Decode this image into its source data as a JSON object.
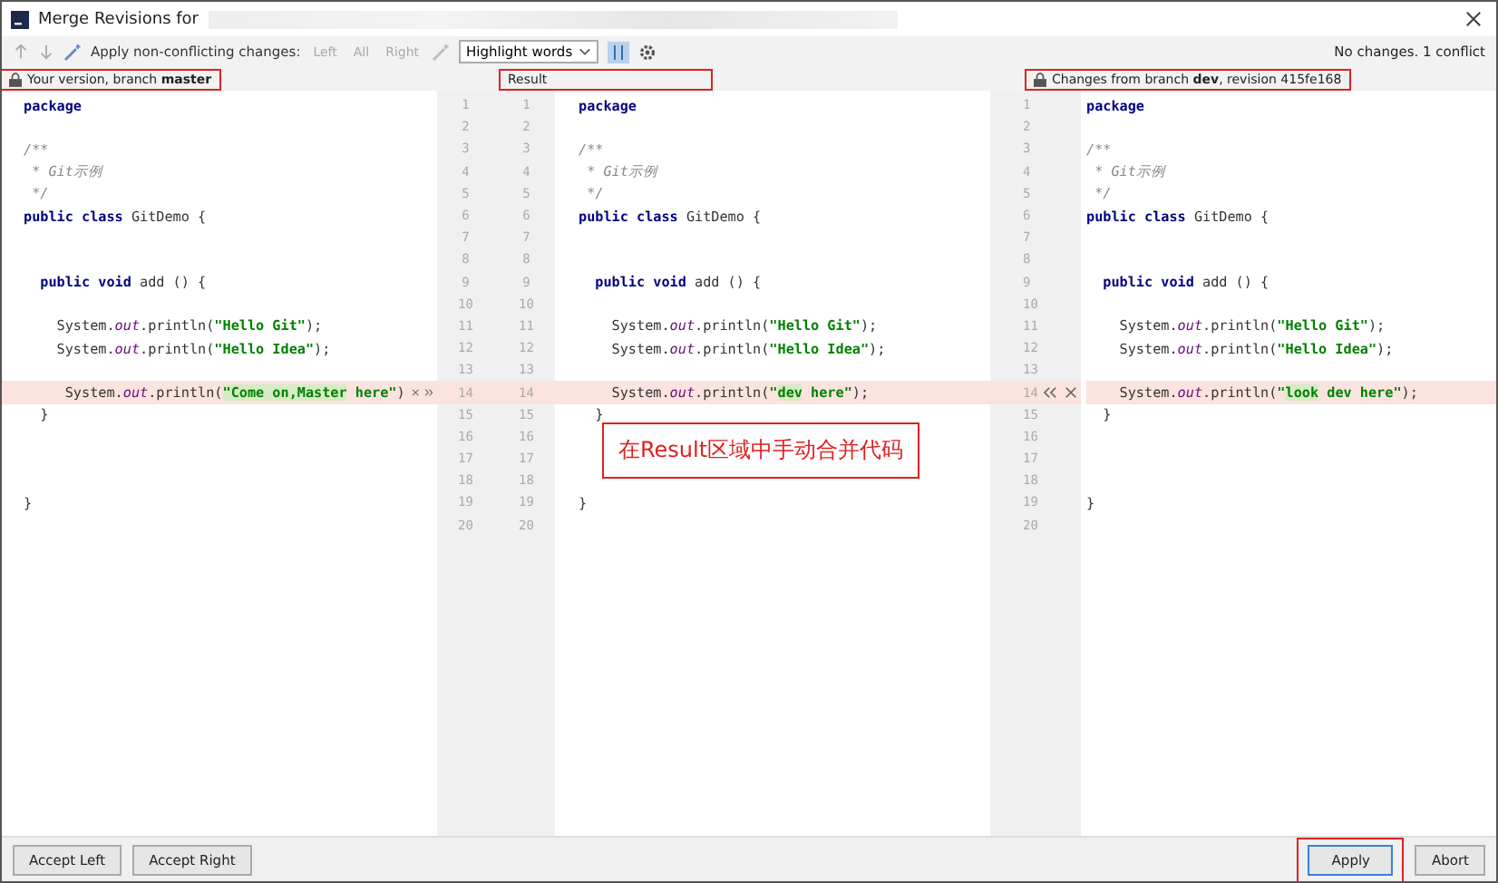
{
  "window": {
    "title": "Merge Revisions for"
  },
  "toolbar": {
    "apply_label": "Apply non-conflicting changes:",
    "apply_buttons": [
      {
        "label": "Left",
        "disabled": true
      },
      {
        "label": "All",
        "disabled": true
      },
      {
        "label": "Right",
        "disabled": true
      }
    ],
    "highlight_select": "Highlight words",
    "status": "No changes. 1 conflict"
  },
  "headers": [
    {
      "text": "Your version, branch **master**",
      "locked": true,
      "highlighted": true
    },
    {
      "text": "Result",
      "locked": false,
      "highlighted": true
    },
    {
      "text": "Changes from branch **dev**, revision 415fe168",
      "locked": true,
      "highlighted": true
    }
  ],
  "panes": [
    {
      "lines": [
        {
          "number": "1",
          "conflict": false,
          "tokens": [
            {
              "kind": "kw",
              "text": "package"
            }
          ]
        },
        {
          "number": "2",
          "conflict": false
        },
        {
          "number": "3",
          "conflict": false,
          "tokens": [
            {
              "kind": "comment",
              "text": "/**"
            }
          ]
        },
        {
          "number": "4",
          "conflict": false,
          "tokens": [
            {
              "kind": "comment",
              "text": " * Git示例"
            }
          ]
        },
        {
          "number": "5",
          "conflict": false,
          "tokens": [
            {
              "kind": "comment",
              "text": " */"
            }
          ]
        },
        {
          "number": "6",
          "conflict": false,
          "tokens": [
            {
              "kind": "kw",
              "text": "public class "
            },
            {
              "kind": "plain",
              "text": "GitDemo {"
            }
          ]
        },
        {
          "number": "7",
          "conflict": false
        },
        {
          "number": "8",
          "conflict": false
        },
        {
          "number": "9",
          "conflict": false,
          "tokens": [
            {
              "kind": "kw",
              "text": "  public void "
            },
            {
              "kind": "plain",
              "text": "add () {"
            }
          ]
        },
        {
          "number": "10",
          "conflict": false
        },
        {
          "number": "11",
          "conflict": false,
          "tokens": [
            {
              "kind": "plain",
              "text": "    System."
            },
            {
              "kind": "field",
              "text": "out"
            },
            {
              "kind": "plain",
              "text": ".println("
            },
            {
              "kind": "str",
              "text": "\"Hello Git\""
            },
            {
              "kind": "plain",
              "text": ");"
            }
          ]
        },
        {
          "number": "12",
          "conflict": false,
          "tokens": [
            {
              "kind": "plain",
              "text": "    System."
            },
            {
              "kind": "field",
              "text": "out"
            },
            {
              "kind": "plain",
              "text": ".println("
            },
            {
              "kind": "str",
              "text": "\"Hello Idea\""
            },
            {
              "kind": "plain",
              "text": ");"
            }
          ]
        },
        {
          "number": "13",
          "conflict": false
        },
        {
          "number": "14",
          "conflict": true,
          "tokens": [
            {
              "kind": "plain",
              "text": "     System."
            },
            {
              "kind": "field",
              "text": "out"
            },
            {
              "kind": "plain",
              "text": ".println("
            },
            {
              "kind": "str_changed",
              "text": "\"Come on,Master"
            },
            {
              "kind": "str",
              "text": " here\""
            },
            {
              "kind": "plain",
              "text": ")"
            }
          ]
        },
        {
          "number": "15",
          "conflict": false,
          "tokens": [
            {
              "kind": "plain",
              "text": "  }"
            }
          ]
        },
        {
          "number": "16",
          "conflict": false
        },
        {
          "number": "17",
          "conflict": false
        },
        {
          "number": "18",
          "conflict": false
        },
        {
          "number": "19",
          "conflict": false,
          "tokens": [
            {
              "kind": "plain",
              "text": "}"
            }
          ]
        },
        {
          "number": "20",
          "conflict": false
        }
      ]
    },
    {
      "lines": [
        {
          "number": "1",
          "conflict": false,
          "tokens": [
            {
              "kind": "kw",
              "text": "package"
            }
          ]
        },
        {
          "number": "2",
          "conflict": false
        },
        {
          "number": "3",
          "conflict": false,
          "tokens": [
            {
              "kind": "comment",
              "text": "/**"
            }
          ]
        },
        {
          "number": "4",
          "conflict": false,
          "tokens": [
            {
              "kind": "comment",
              "text": " * Git示例"
            }
          ]
        },
        {
          "number": "5",
          "conflict": false,
          "tokens": [
            {
              "kind": "comment",
              "text": " */"
            }
          ]
        },
        {
          "number": "6",
          "conflict": false,
          "tokens": [
            {
              "kind": "kw",
              "text": "public class "
            },
            {
              "kind": "plain",
              "text": "GitDemo {"
            }
          ]
        },
        {
          "number": "7",
          "conflict": false
        },
        {
          "number": "8",
          "conflict": false
        },
        {
          "number": "9",
          "conflict": false,
          "tokens": [
            {
              "kind": "kw",
              "text": "  public void "
            },
            {
              "kind": "plain",
              "text": "add () {"
            }
          ]
        },
        {
          "number": "10",
          "conflict": false
        },
        {
          "number": "11",
          "conflict": false,
          "tokens": [
            {
              "kind": "plain",
              "text": "    System."
            },
            {
              "kind": "field",
              "text": "out"
            },
            {
              "kind": "plain",
              "text": ".println("
            },
            {
              "kind": "str",
              "text": "\"Hello Git\""
            },
            {
              "kind": "plain",
              "text": ");"
            }
          ]
        },
        {
          "number": "12",
          "conflict": false,
          "tokens": [
            {
              "kind": "plain",
              "text": "    System."
            },
            {
              "kind": "field",
              "text": "out"
            },
            {
              "kind": "plain",
              "text": ".println("
            },
            {
              "kind": "str",
              "text": "\"Hello Idea\""
            },
            {
              "kind": "plain",
              "text": ");"
            }
          ]
        },
        {
          "number": "13",
          "conflict": false
        },
        {
          "number": "14",
          "conflict": true,
          "tokens": [
            {
              "kind": "plain",
              "text": "    System."
            },
            {
              "kind": "field",
              "text": "out"
            },
            {
              "kind": "plain",
              "text": ".println("
            },
            {
              "kind": "str",
              "text": "\""
            },
            {
              "kind": "str_changed",
              "text": "dev"
            },
            {
              "kind": "str",
              "text": " here\""
            },
            {
              "kind": "plain",
              "text": ");"
            }
          ]
        },
        {
          "number": "15",
          "conflict": false,
          "tokens": [
            {
              "kind": "plain",
              "text": "  }"
            }
          ]
        },
        {
          "number": "16",
          "conflict": false
        },
        {
          "number": "17",
          "conflict": false
        },
        {
          "number": "18",
          "conflict": false
        },
        {
          "number": "19",
          "conflict": false,
          "tokens": [
            {
              "kind": "plain",
              "text": "}"
            }
          ]
        },
        {
          "number": "20",
          "conflict": false
        }
      ]
    },
    {
      "lines": [
        {
          "number": "1",
          "conflict": false,
          "tokens": [
            {
              "kind": "kw",
              "text": "package"
            }
          ]
        },
        {
          "number": "2",
          "conflict": false
        },
        {
          "number": "3",
          "conflict": false,
          "tokens": [
            {
              "kind": "comment",
              "text": "/**"
            }
          ]
        },
        {
          "number": "4",
          "conflict": false,
          "tokens": [
            {
              "kind": "comment",
              "text": " * Git示例"
            }
          ]
        },
        {
          "number": "5",
          "conflict": false,
          "tokens": [
            {
              "kind": "comment",
              "text": " */"
            }
          ]
        },
        {
          "number": "6",
          "conflict": false,
          "tokens": [
            {
              "kind": "kw",
              "text": "public class "
            },
            {
              "kind": "plain",
              "text": "GitDemo {"
            }
          ]
        },
        {
          "number": "7",
          "conflict": false
        },
        {
          "number": "8",
          "conflict": false
        },
        {
          "number": "9",
          "conflict": false,
          "tokens": [
            {
              "kind": "kw",
              "text": "  public void "
            },
            {
              "kind": "plain",
              "text": "add () {"
            }
          ]
        },
        {
          "number": "10",
          "conflict": false
        },
        {
          "number": "11",
          "conflict": false,
          "tokens": [
            {
              "kind": "plain",
              "text": "    System."
            },
            {
              "kind": "field",
              "text": "out"
            },
            {
              "kind": "plain",
              "text": ".println("
            },
            {
              "kind": "str",
              "text": "\"Hello Git\""
            },
            {
              "kind": "plain",
              "text": ");"
            }
          ]
        },
        {
          "number": "12",
          "conflict": false,
          "tokens": [
            {
              "kind": "plain",
              "text": "    System."
            },
            {
              "kind": "field",
              "text": "out"
            },
            {
              "kind": "plain",
              "text": ".println("
            },
            {
              "kind": "str",
              "text": "\"Hello Idea\""
            },
            {
              "kind": "plain",
              "text": ");"
            }
          ]
        },
        {
          "number": "13",
          "conflict": false
        },
        {
          "number": "14",
          "conflict": true,
          "tokens": [
            {
              "kind": "plain",
              "text": "    System."
            },
            {
              "kind": "field",
              "text": "out"
            },
            {
              "kind": "plain",
              "text": ".println("
            },
            {
              "kind": "str",
              "text": "\""
            },
            {
              "kind": "str_changed",
              "text": "look"
            },
            {
              "kind": "str",
              "text": " dev here\""
            },
            {
              "kind": "plain",
              "text": ");"
            }
          ]
        },
        {
          "number": "15",
          "conflict": false,
          "tokens": [
            {
              "kind": "plain",
              "text": "  }"
            }
          ]
        },
        {
          "number": "16",
          "conflict": false
        },
        {
          "number": "17",
          "conflict": false
        },
        {
          "number": "18",
          "conflict": false
        },
        {
          "number": "19",
          "conflict": false,
          "tokens": [
            {
              "kind": "plain",
              "text": "}"
            }
          ]
        },
        {
          "number": "20",
          "conflict": false
        }
      ]
    }
  ],
  "annotation": {
    "text": "在Result区域中手动合并代码"
  },
  "buttons": [
    {
      "label": "Accept Left",
      "primary": false,
      "highlighted": false
    },
    {
      "label": "Accept Right",
      "primary": false,
      "highlighted": false
    },
    {
      "label": "Apply",
      "primary": true,
      "highlighted": true
    },
    {
      "label": "Abort",
      "primary": false,
      "highlighted": false
    }
  ]
}
